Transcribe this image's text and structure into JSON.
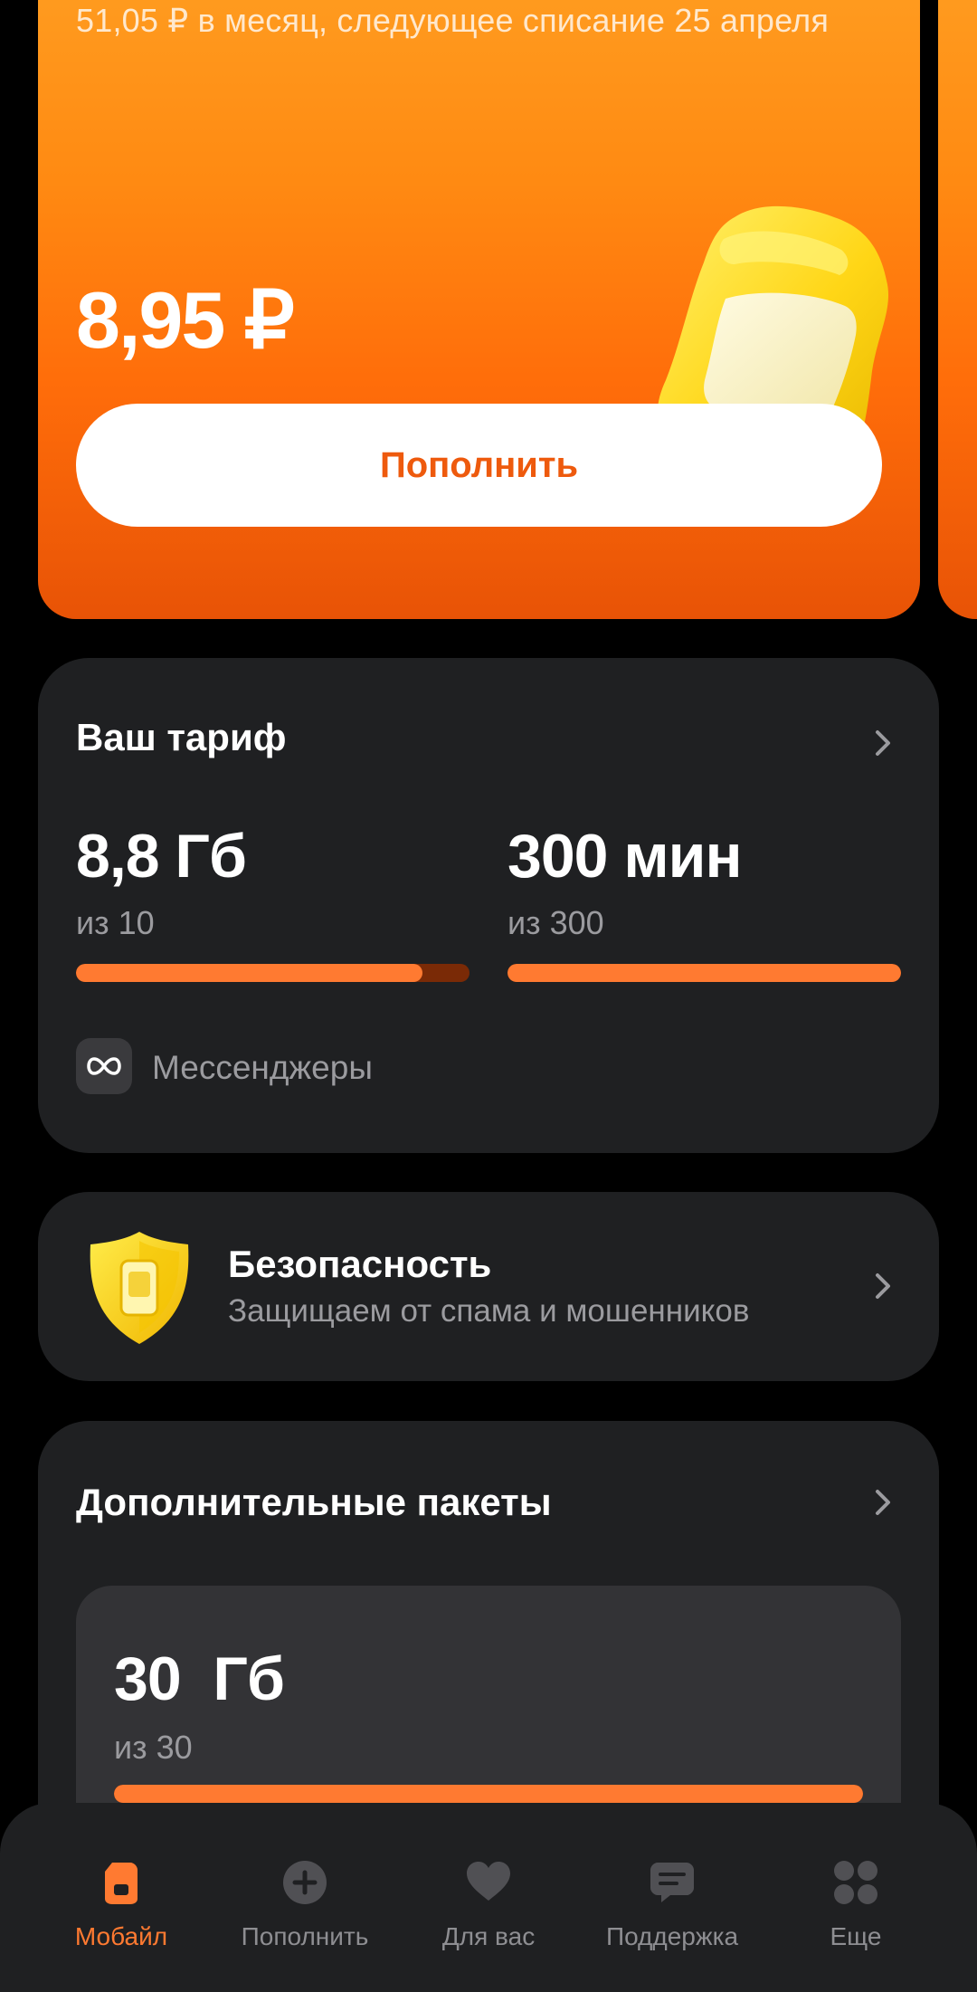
{
  "balance": {
    "subscription_text": "51,05 ₽ в месяц, следующее списание 25 апреля",
    "amount": "8,95 ₽",
    "topup_button": "Пополнить"
  },
  "tariff": {
    "title": "Ваш тариф",
    "data": {
      "value": "8,8 Гб",
      "sub": "из 10",
      "fraction": 0.88
    },
    "minutes": {
      "value": "300 мин",
      "sub": "из 300",
      "fraction": 1.0
    },
    "messengers_label": "Мессенджеры"
  },
  "security": {
    "title": "Безопасность",
    "subtitle": "Защищаем от спама и мошенников"
  },
  "packages": {
    "title": "Дополнительные пакеты",
    "item": {
      "value": "30  Гб",
      "sub": "из 30",
      "fraction": 1.0
    }
  },
  "nav": {
    "items": [
      {
        "label": "Мобайл",
        "icon": "sim-icon",
        "active": true
      },
      {
        "label": "Пополнить",
        "icon": "plus-circle-icon",
        "active": false
      },
      {
        "label": "Для вас",
        "icon": "heart-icon",
        "active": false
      },
      {
        "label": "Поддержка",
        "icon": "chat-icon",
        "active": false
      },
      {
        "label": "Еще",
        "icon": "grid-icon",
        "active": false
      }
    ]
  },
  "colors": {
    "accent": "#ff7a31",
    "card_bg": "#1f2022",
    "muted_text": "#9b9b9f"
  }
}
